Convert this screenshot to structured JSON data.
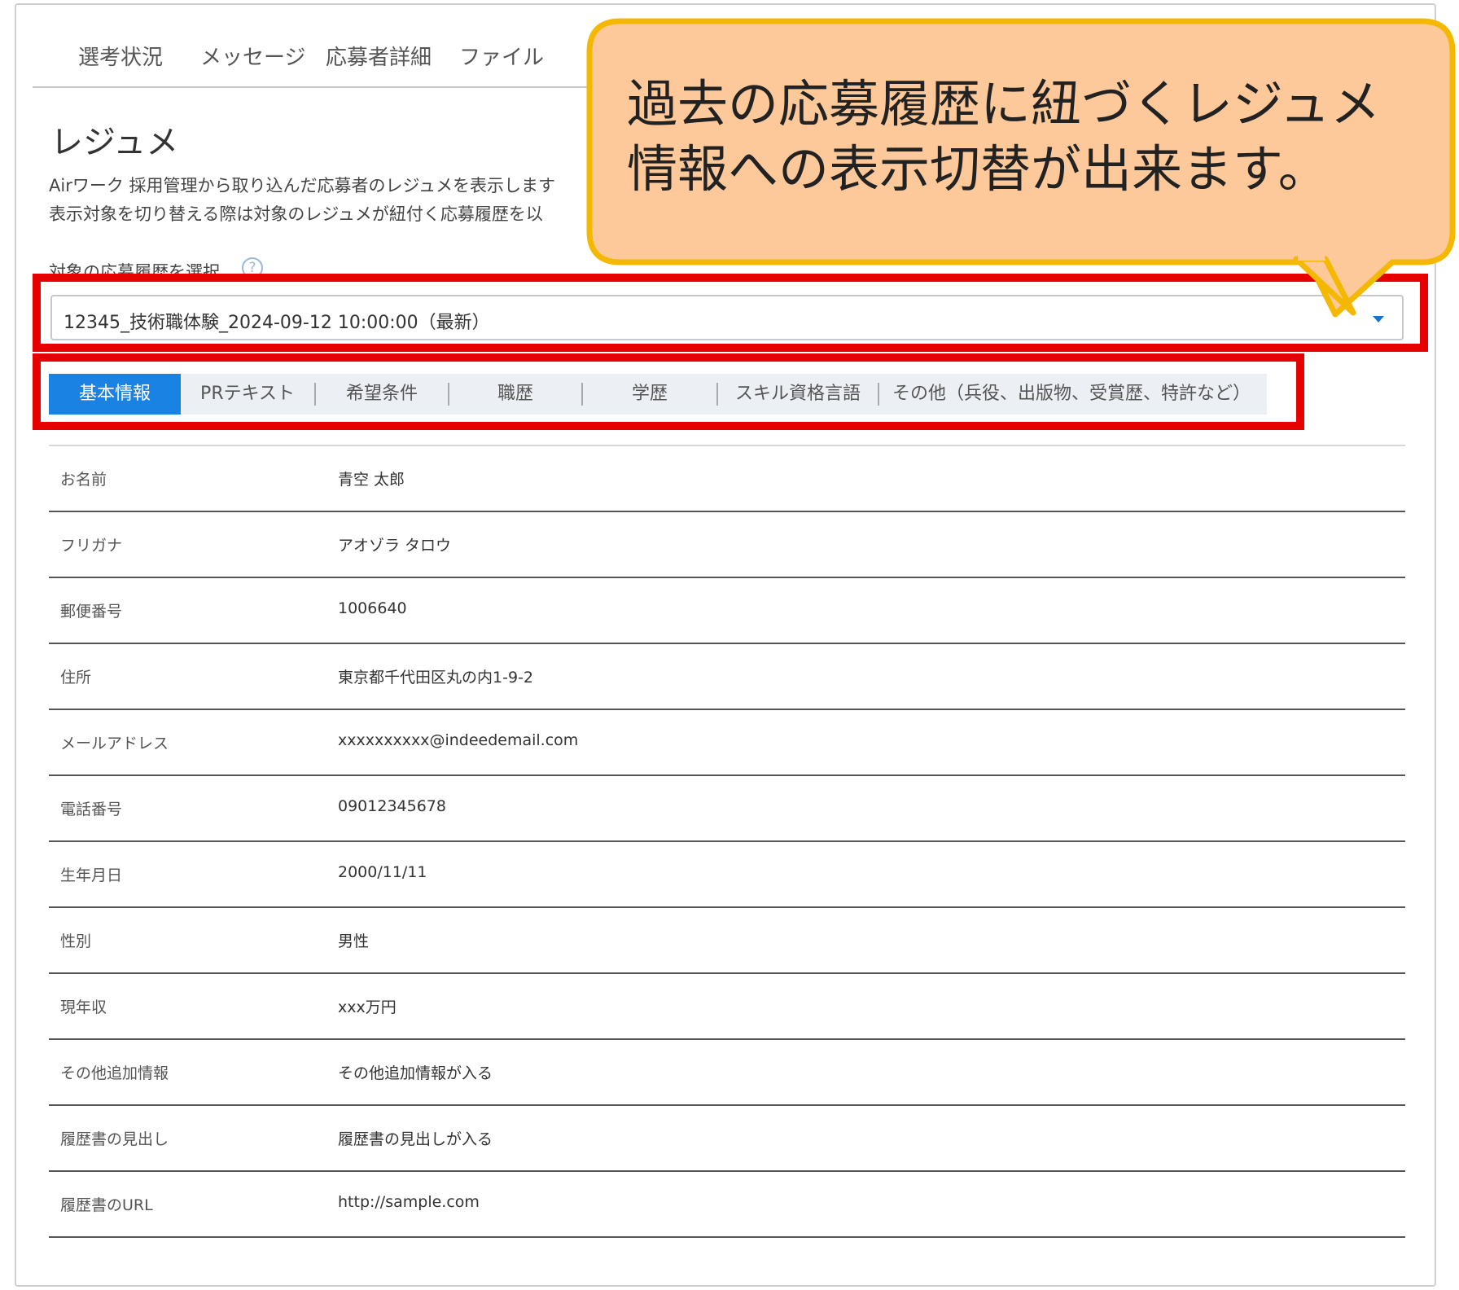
{
  "top_tabs": [
    "選考状況",
    "メッセージ",
    "応募者詳細",
    "ファイル"
  ],
  "page_title": "レジュメ",
  "description": {
    "line1": "Airワーク 採用管理から取り込んだ応募者のレジュメを表示します",
    "line2": "表示対象を切り替える際は対象のレジュメが紐付く応募履歴を以"
  },
  "select": {
    "label": "対象の応募履歴を選択",
    "help_icon": "question-circle-icon",
    "value": "12345_技術職体験_2024-09-12 10:00:00（最新）"
  },
  "sub_tabs": [
    "基本情報",
    "PRテキスト",
    "希望条件",
    "職歴",
    "学歴",
    "スキル資格言語",
    "その他（兵役、出版物、受賞歴、特許など）"
  ],
  "active_sub_tab": "基本情報",
  "rows": [
    {
      "label": "お名前",
      "value": "青空 太郎"
    },
    {
      "label": "フリガナ",
      "value": "アオゾラ タロウ"
    },
    {
      "label": "郵便番号",
      "value": "1006640"
    },
    {
      "label": "住所",
      "value": "東京都千代田区丸の内1-9-2"
    },
    {
      "label": "メールアドレス",
      "value": "xxxxxxxxxx@indeedemail.com"
    },
    {
      "label": "電話番号",
      "value": "09012345678"
    },
    {
      "label": "生年月日",
      "value": "2000/11/11"
    },
    {
      "label": "性別",
      "value": "男性"
    },
    {
      "label": "現年収",
      "value": "xxx万円"
    },
    {
      "label": "その他追加情報",
      "value": "その他追加情報が入る"
    },
    {
      "label": "履歴書の見出し",
      "value": "履歴書の見出しが入る"
    },
    {
      "label": "履歴書のURL",
      "value": "http://sample.com"
    }
  ],
  "callout": {
    "line1": "過去の応募履歴に紐づくレジュメ",
    "line2": "情報への表示切替が出来ます。"
  },
  "colors": {
    "highlight_border": "#e60000",
    "callout_fill": "#fdc99a",
    "callout_border": "#f5b800",
    "active_tab": "#1a82e2"
  }
}
